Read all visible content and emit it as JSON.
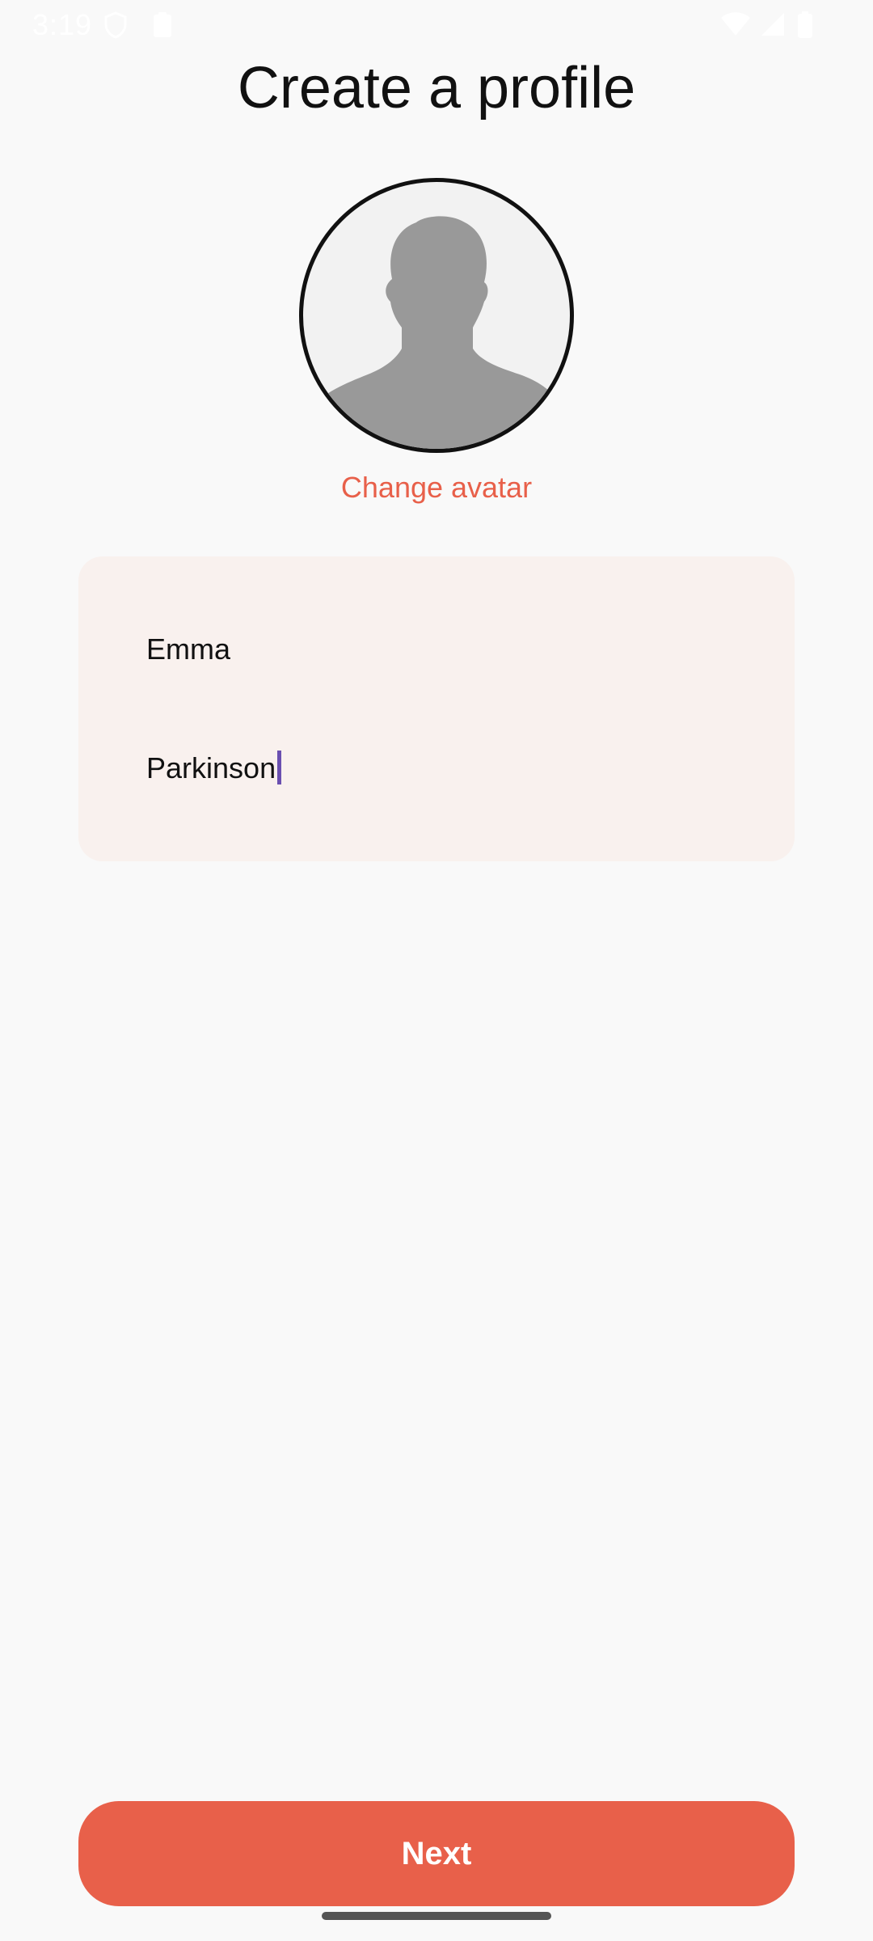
{
  "status_bar": {
    "time": "3:19",
    "icons": [
      "shield-icon",
      "clipboard-icon",
      "wifi-icon",
      "signal-icon",
      "battery-icon"
    ]
  },
  "page": {
    "title": "Create a profile"
  },
  "avatar": {
    "icon": "person-silhouette-icon",
    "change_label": "Change avatar"
  },
  "form": {
    "first_name": "Emma",
    "last_name": "Parkinson"
  },
  "actions": {
    "next_label": "Next"
  },
  "colors": {
    "accent": "#e8604a",
    "card_background": "#f9f1ee",
    "page_background": "#f9f9f9",
    "cursor": "#6a4fb0"
  }
}
